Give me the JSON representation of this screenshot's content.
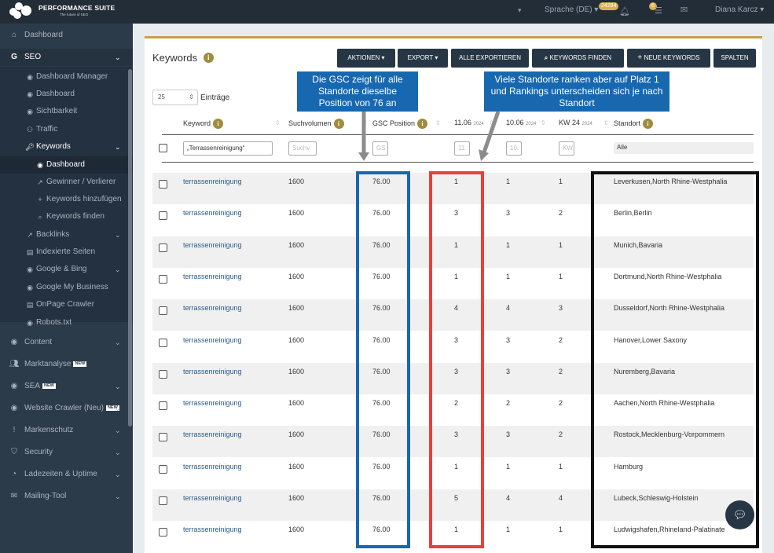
{
  "app": {
    "brand": "PERFORMANCE SUITE",
    "tagline": "The future of SEO",
    "language": "Sprache (DE)",
    "badge_count": "24284",
    "notif_count": "6",
    "user": "Diana Karcz"
  },
  "sidebar": {
    "dashboard": "Dashboard",
    "seo": "SEO",
    "seo_items": [
      "Dashboard Manager",
      "Dashboard",
      "Sichtbarkeit",
      "Traffic"
    ],
    "keywords": "Keywords",
    "keyword_items": [
      "Dashboard",
      "Gewinner / Verlierer",
      "Keywords hinzufügen",
      "Keywords finden"
    ],
    "seo_items2": [
      "Backlinks",
      "Indexierte Seiten",
      "Google & Bing",
      "Google My Business",
      "OnPage Crawler",
      "Robots.txt"
    ],
    "main_items": [
      "Content",
      "Marktanalyse",
      "SEA",
      "Website Crawler (Neu)",
      "Markenschutz",
      "Security",
      "Ladezeiten & Uptime",
      "Mailing-Tool"
    ],
    "new_label": "NEW"
  },
  "page": {
    "title": "Keywords",
    "buttons": {
      "actions": "AKTIONEN",
      "export": "EXPORT",
      "export_all": "ALLE EXPORTIEREN",
      "find": "KEYWORDS FINDEN",
      "new": "NEUE KEYWORDS",
      "columns": "SPALTEN"
    },
    "entries_value": "25",
    "entries_label": "Einträge"
  },
  "table": {
    "headers": {
      "keyword": "Keyword",
      "volume": "Suchvolumen",
      "gsc": "GSC Position",
      "d1": "11.06",
      "d1_year": "2024",
      "d2": "10.06",
      "d2_year": "2024",
      "kw": "KW 24",
      "kw_year": "2024",
      "location": "Standort"
    },
    "filters": {
      "keyword": "„Terrassenreinigung“",
      "volume": "Suchv",
      "gsc": "GS",
      "d1": "11.",
      "d2": "10.",
      "kw": "KW",
      "location": "Alle"
    },
    "rows": [
      {
        "keyword": "terrassenreinigung",
        "volume": "1600",
        "gsc": "76.00",
        "d1": "1",
        "d2": "1",
        "kw": "1",
        "location": "Leverkusen,North Rhine-Westphalia"
      },
      {
        "keyword": "terrassenreinigung",
        "volume": "1600",
        "gsc": "76.00",
        "d1": "3",
        "d2": "3",
        "kw": "2",
        "location": "Berlin,Berlin"
      },
      {
        "keyword": "terrassenreinigung",
        "volume": "1600",
        "gsc": "76.00",
        "d1": "1",
        "d2": "1",
        "kw": "1",
        "location": "Munich,Bavaria"
      },
      {
        "keyword": "terrassenreinigung",
        "volume": "1600",
        "gsc": "76.00",
        "d1": "1",
        "d2": "1",
        "kw": "1",
        "location": "Dortmund,North Rhine-Westphalia"
      },
      {
        "keyword": "terrassenreinigung",
        "volume": "1600",
        "gsc": "76.00",
        "d1": "4",
        "d2": "4",
        "kw": "3",
        "location": "Dusseldorf,North Rhine-Westphalia"
      },
      {
        "keyword": "terrassenreinigung",
        "volume": "1600",
        "gsc": "76.00",
        "d1": "3",
        "d2": "3",
        "kw": "2",
        "location": "Hanover,Lower Saxony"
      },
      {
        "keyword": "terrassenreinigung",
        "volume": "1600",
        "gsc": "76.00",
        "d1": "3",
        "d2": "3",
        "kw": "2",
        "location": "Nuremberg,Bavaria"
      },
      {
        "keyword": "terrassenreinigung",
        "volume": "1600",
        "gsc": "76.00",
        "d1": "2",
        "d2": "2",
        "kw": "2",
        "location": "Aachen,North Rhine-Westphalia"
      },
      {
        "keyword": "terrassenreinigung",
        "volume": "1600",
        "gsc": "76.00",
        "d1": "3",
        "d2": "3",
        "kw": "2",
        "location": "Rostock,Mecklenburg-Vorpommern"
      },
      {
        "keyword": "terrassenreinigung",
        "volume": "1600",
        "gsc": "76.00",
        "d1": "1",
        "d2": "1",
        "kw": "1",
        "location": "Hamburg"
      },
      {
        "keyword": "terrassenreinigung",
        "volume": "1600",
        "gsc": "76.00",
        "d1": "5",
        "d2": "4",
        "kw": "4",
        "location": "Lubeck,Schleswig-Holstein"
      },
      {
        "keyword": "terrassenreinigung",
        "volume": "1600",
        "gsc": "76.00",
        "d1": "1",
        "d2": "1",
        "kw": "1",
        "location": "Ludwigshafen,Rhineland-Palatinate"
      }
    ]
  },
  "annotations": {
    "gsc_note": "Die GSC zeigt für alle Standorte dieselbe Position von 76 an",
    "rank_note": "Viele Standorte ranken aber auf Platz 1 und Rankings unterscheiden sich je nach Standort",
    "colors": {
      "blue": "#1868b0",
      "red": "#e8403a",
      "black": "#111111"
    }
  }
}
